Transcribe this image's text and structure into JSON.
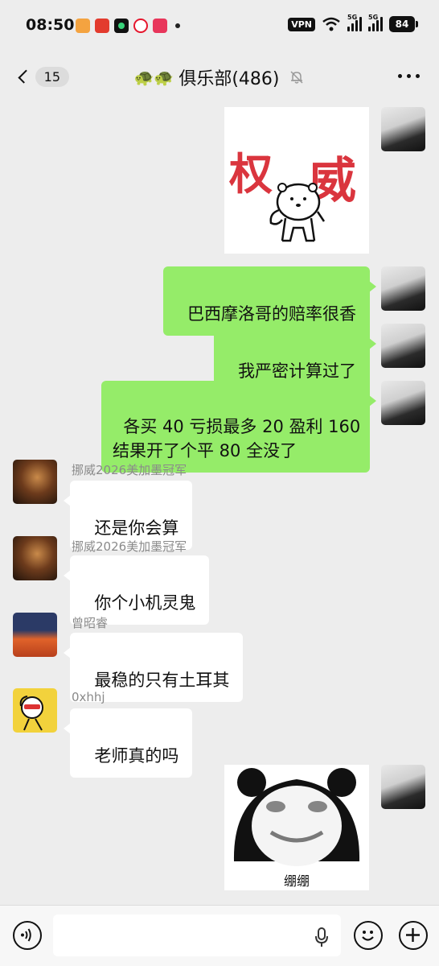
{
  "status_bar": {
    "time": "08:50",
    "vpn_label": "VPN",
    "signal1_label": "5G",
    "signal2_label": "5G",
    "battery": "84"
  },
  "nav": {
    "back_count": "15",
    "title_emoji": "🐢🐢",
    "title": "俱乐部(486)"
  },
  "messages": [
    {
      "side": "me",
      "type": "sticker",
      "sticker_text": [
        "权",
        "威"
      ]
    },
    {
      "side": "me",
      "type": "text",
      "text": "巴西摩洛哥的赔率很香"
    },
    {
      "side": "me",
      "type": "text",
      "text": "我严密计算过了"
    },
    {
      "side": "me",
      "type": "text",
      "text": "各买 40 亏损最多 20 盈利 160\n结果开了个平 80 全没了"
    },
    {
      "side": "other",
      "sender": "挪威2026美加墨冠军",
      "type": "text",
      "text": "还是你会算"
    },
    {
      "side": "other",
      "sender": "挪威2026美加墨冠军",
      "type": "text",
      "text": "你个小机灵鬼"
    },
    {
      "side": "other",
      "sender": "曾昭睿",
      "type": "text",
      "text": "最稳的只有土耳其"
    },
    {
      "side": "other",
      "sender": "0xhhj",
      "type": "text",
      "text": "老师真的吗"
    },
    {
      "side": "me",
      "type": "sticker",
      "sticker_caption": "绷绷"
    }
  ],
  "icons": {
    "back": "chevron-left-icon",
    "mute": "bell-off-icon",
    "more": "more-dots-icon",
    "voice": "voice-icon",
    "mic": "mic-icon",
    "emoji": "emoji-icon",
    "add": "plus-icon"
  },
  "colors": {
    "background": "#ededed",
    "my_bubble": "#95ec69",
    "other_bubble": "#ffffff",
    "sticker_red": "#d6202a"
  }
}
